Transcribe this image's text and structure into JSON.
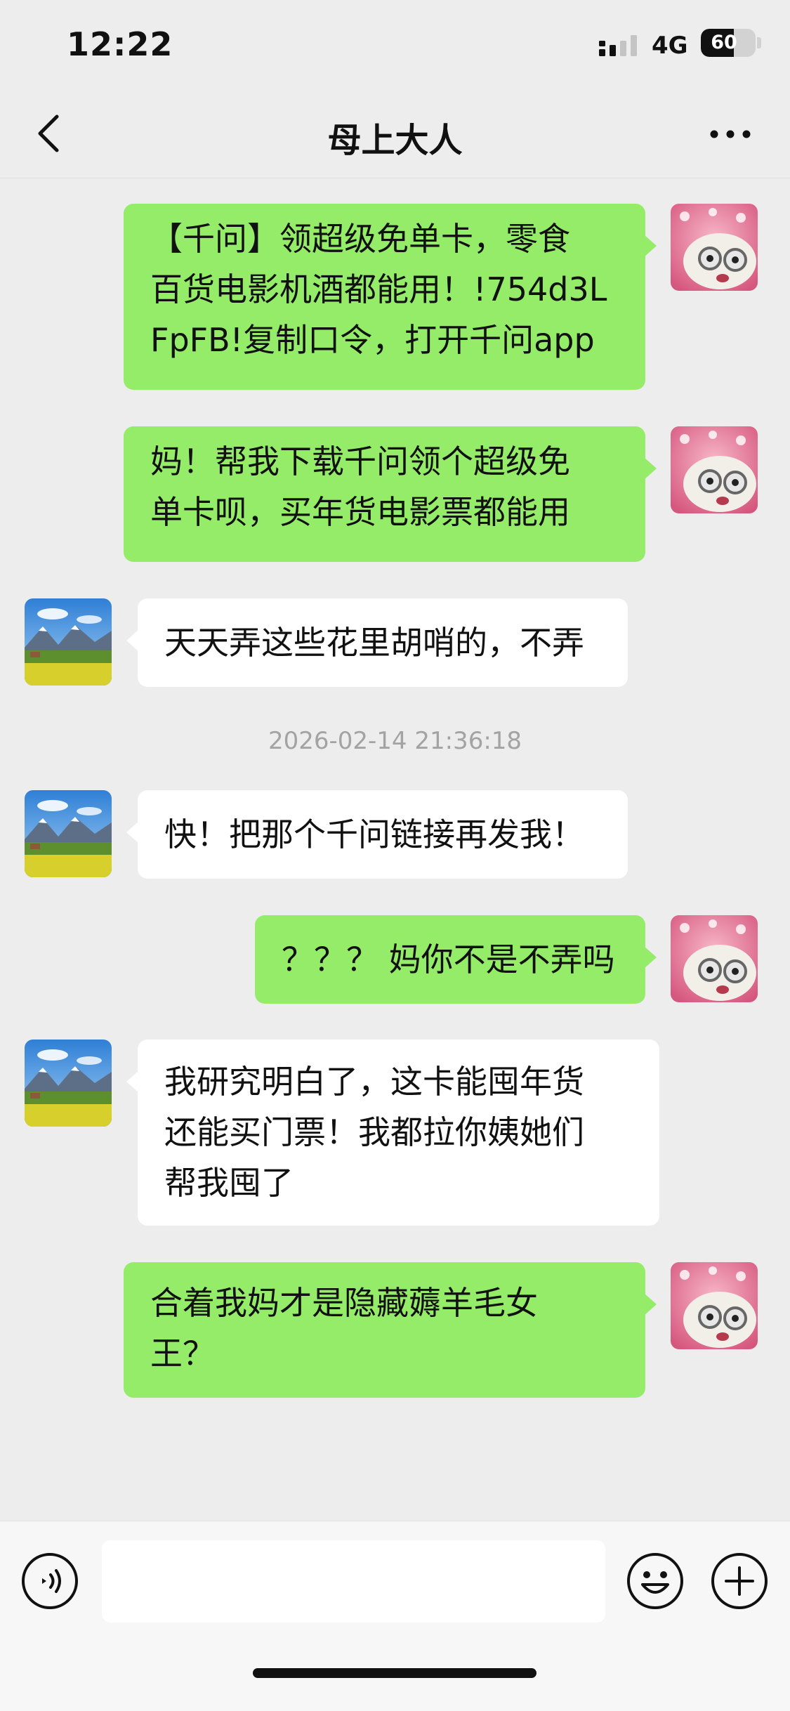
{
  "status_bar": {
    "time": "12:22",
    "network": "4G",
    "battery": "60",
    "battery_level_percent": 60
  },
  "nav": {
    "title": "母上大人",
    "back_icon": "chevron-left-icon",
    "more_icon": "more-horizontal-icon"
  },
  "messages": [
    {
      "from": "me",
      "text": "【千问】领超级免单卡，零食\n百货电影机酒都能用！!754d3L\nFpFB!复制口令，打开千问app"
    },
    {
      "from": "me",
      "text": "妈！帮我下载千问领个超级免\n单卡呗，买年货电影票都能用"
    },
    {
      "from": "mom",
      "text": "天天弄这些花里胡哨的，不弄"
    },
    {
      "from": "mom",
      "text": "快！把那个千问链接再发我！"
    },
    {
      "from": "me",
      "text": "？？？ 妈你不是不弄吗"
    },
    {
      "from": "mom",
      "text": "我研究明白了，这卡能囤年货\n还能买门票！我都拉你姨她们\n帮我囤了"
    },
    {
      "from": "me",
      "text": "合着我妈才是隐藏薅羊毛女\n王？"
    }
  ],
  "timestamp": "2026-02-14 21:36:18",
  "input_bar": {
    "input_value": "",
    "voice_icon": "voice-icon",
    "emoji_icon": "emoji-icon",
    "plus_icon": "plus-icon"
  },
  "colors": {
    "my_bubble": "#95ec69",
    "mom_bubble": "#ffffff",
    "background": "#ededed",
    "timestamp_text": "#a3a3a3"
  }
}
